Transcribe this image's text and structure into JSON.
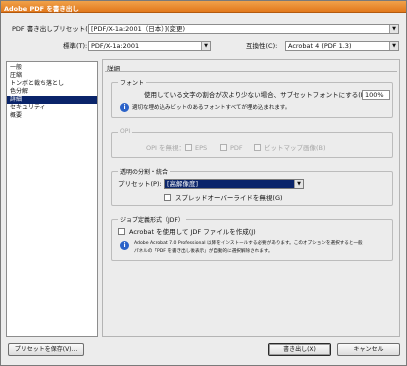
{
  "window": {
    "title": "Adobe PDF を書き出し"
  },
  "preset": {
    "label": "PDF 書き出しプリセット(S):",
    "value": "[PDF/X-1a:2001（日本）](変更)"
  },
  "standard": {
    "label": "標準(T):",
    "value": "PDF/X-1a:2001"
  },
  "compat": {
    "label": "互換性(C):",
    "value": "Acrobat 4 (PDF 1.3)"
  },
  "sidebar": {
    "items": [
      {
        "label": "一般"
      },
      {
        "label": "圧縮"
      },
      {
        "label": "トンボと裁ち落とし"
      },
      {
        "label": "色分解"
      },
      {
        "label": "詳細"
      },
      {
        "label": "セキュリティ"
      },
      {
        "label": "概要"
      }
    ],
    "selected_index": 4
  },
  "panel": {
    "title": "詳細",
    "fonts": {
      "legend": "フォント",
      "subset_label": "使用している文字の割合が次より少ない場合、サブセットフォントにする(M):",
      "subset_value": "100%",
      "note": "適切な埋め込みビットのあるフォントすべてが埋め込まれます。"
    },
    "opi": {
      "legend": "OPI",
      "omit_label": "OPI を無視：",
      "eps": "EPS",
      "pdf": "PDF",
      "bitmap": "ビットマップ画像(B)"
    },
    "transparency": {
      "legend": "透明の分割・統合",
      "preset_label": "プリセット(P):",
      "preset_value": "[高解像度]",
      "ignore_overrides": "スプレッドオーバーライドを無視(G)"
    },
    "jdf": {
      "legend": "ジョブ定義形式（JDF）",
      "create_label": "Acrobat を使用して JDF ファイルを作成(J)",
      "note_line1": "Adobe Acrobat 7.0 Professional 以降をインストールする必要があります。このオプションを選択すると一般",
      "note_line2": "パネルの「PDF を書き出し後表示」が自動的に選択解除されます。"
    }
  },
  "footer": {
    "save_preset": "プリセットを保存(V)...",
    "export": "書き出し(X)",
    "cancel": "キャンセル"
  }
}
